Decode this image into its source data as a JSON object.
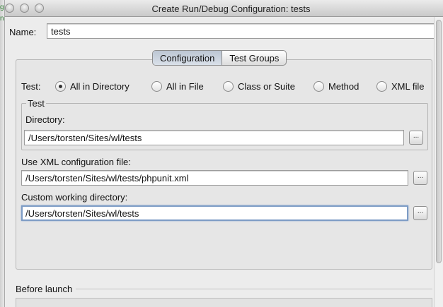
{
  "window": {
    "title": "Create Run/Debug Configuration: tests"
  },
  "name": {
    "label": "Name:",
    "value": "tests"
  },
  "tabs": [
    {
      "label": "Configuration",
      "active": true
    },
    {
      "label": "Test Groups",
      "active": false
    }
  ],
  "test": {
    "label": "Test:",
    "options": [
      {
        "label": "All in Directory",
        "checked": true
      },
      {
        "label": "All in File",
        "checked": false
      },
      {
        "label": "Class or Suite",
        "checked": false
      },
      {
        "label": "Method",
        "checked": false
      },
      {
        "label": "XML file",
        "checked": false
      }
    ]
  },
  "test_group": {
    "title": "Test",
    "directory_label": "Directory:",
    "directory_value": "/Users/torsten/Sites/wl/tests"
  },
  "xml_config": {
    "label": "Use XML configuration file:",
    "value": "/Users/torsten/Sites/wl/tests/phpunit.xml"
  },
  "working_dir": {
    "label": "Custom working directory:",
    "value": "/Users/torsten/Sites/wl/tests"
  },
  "browse_label": "...",
  "before_launch": {
    "label": "Before launch"
  }
}
